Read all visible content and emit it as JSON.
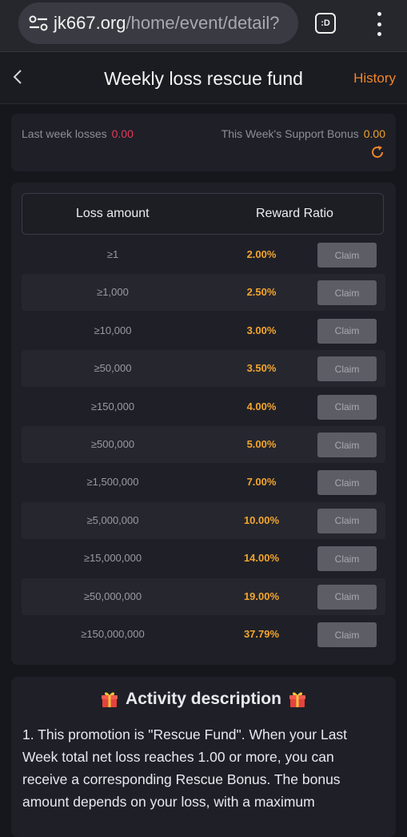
{
  "browser": {
    "url_host": "jk667.org",
    "url_path": "/home/event/detail?",
    "tab_label": ":D"
  },
  "header": {
    "title": "Weekly loss rescue fund",
    "history_label": "History"
  },
  "summary": {
    "last_week_label": "Last week losses",
    "last_week_value": "0.00",
    "support_label": "This Week's Support Bonus",
    "support_value": "0.00"
  },
  "table": {
    "col_loss": "Loss amount",
    "col_ratio": "Reward Ratio",
    "claim_label": "Claim",
    "rows": [
      {
        "amount": "≥1",
        "ratio": "2.00%"
      },
      {
        "amount": "≥1,000",
        "ratio": "2.50%"
      },
      {
        "amount": "≥10,000",
        "ratio": "3.00%"
      },
      {
        "amount": "≥50,000",
        "ratio": "3.50%"
      },
      {
        "amount": "≥150,000",
        "ratio": "4.00%"
      },
      {
        "amount": "≥500,000",
        "ratio": "5.00%"
      },
      {
        "amount": "≥1,500,000",
        "ratio": "7.00%"
      },
      {
        "amount": "≥5,000,000",
        "ratio": "10.00%"
      },
      {
        "amount": "≥15,000,000",
        "ratio": "14.00%"
      },
      {
        "amount": "≥50,000,000",
        "ratio": "19.00%"
      },
      {
        "amount": "≥150,000,000",
        "ratio": "37.79%"
      }
    ]
  },
  "description": {
    "title": "Activity description",
    "text": "1. This promotion is \"Rescue Fund\". When your Last Week total net loss reaches 1.00 or more, you can receive a corresponding Rescue Bonus. The bonus amount depends on your loss, with a maximum"
  },
  "colors": {
    "accent_orange": "#f0852b",
    "ratio_gold": "#f3a52f",
    "loss_red": "#e6395c"
  }
}
